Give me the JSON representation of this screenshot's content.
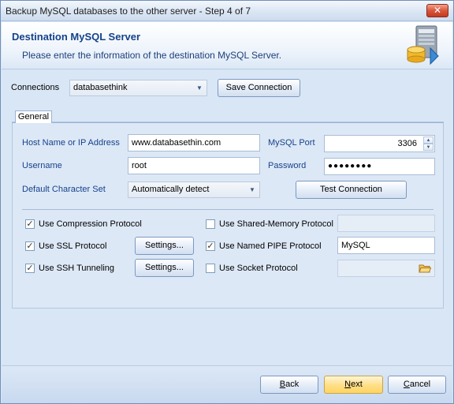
{
  "window": {
    "title": "Backup MySQL databases to the other server - Step 4 of 7",
    "close_label": "✕"
  },
  "header": {
    "title": "Destination MySQL Server",
    "subtitle": "Please enter the information of the destination MySQL Server."
  },
  "connections": {
    "label": "Connections",
    "selected": "databasethink",
    "save_button": "Save Connection"
  },
  "tabs": [
    {
      "label": "General"
    }
  ],
  "form": {
    "host_label": "Host Name or IP Address",
    "host_value": "www.databasethin.com",
    "port_label": "MySQL Port",
    "port_value": "3306",
    "username_label": "Username",
    "username_value": "root",
    "password_label": "Password",
    "password_value": "●●●●●●●●",
    "charset_label": "Default Character Set",
    "charset_value": "Automatically detect",
    "test_button": "Test Connection"
  },
  "options": {
    "compression": {
      "label": "Use Compression Protocol",
      "checked": true
    },
    "ssl": {
      "label": "Use SSL Protocol",
      "checked": true,
      "settings_button": "Settings..."
    },
    "ssh": {
      "label": "Use SSH Tunneling",
      "checked": true,
      "settings_button": "Settings..."
    },
    "shared_memory": {
      "label": "Use Shared-Memory Protocol",
      "checked": false,
      "value": ""
    },
    "named_pipe": {
      "label": "Use Named PIPE Protocol",
      "checked": true,
      "value": "MySQL"
    },
    "socket": {
      "label": "Use Socket Protocol",
      "checked": false,
      "value": ""
    }
  },
  "footer": {
    "back_mnemonic": "B",
    "back_rest": "ack",
    "next_mnemonic": "N",
    "next_rest": "ext",
    "cancel_mnemonic": "C",
    "cancel_rest": "ancel"
  },
  "icons": {
    "close": "close-icon",
    "header": "database-server-icon",
    "dropdown": "chevron-down-icon",
    "spin_up": "spin-up-icon",
    "spin_down": "spin-down-icon",
    "check": "checkmark-icon",
    "folder": "folder-open-icon"
  },
  "colors": {
    "accent_title": "#15428b",
    "window_bg": "#d9e6f5",
    "next_button": "#ffe08c"
  }
}
